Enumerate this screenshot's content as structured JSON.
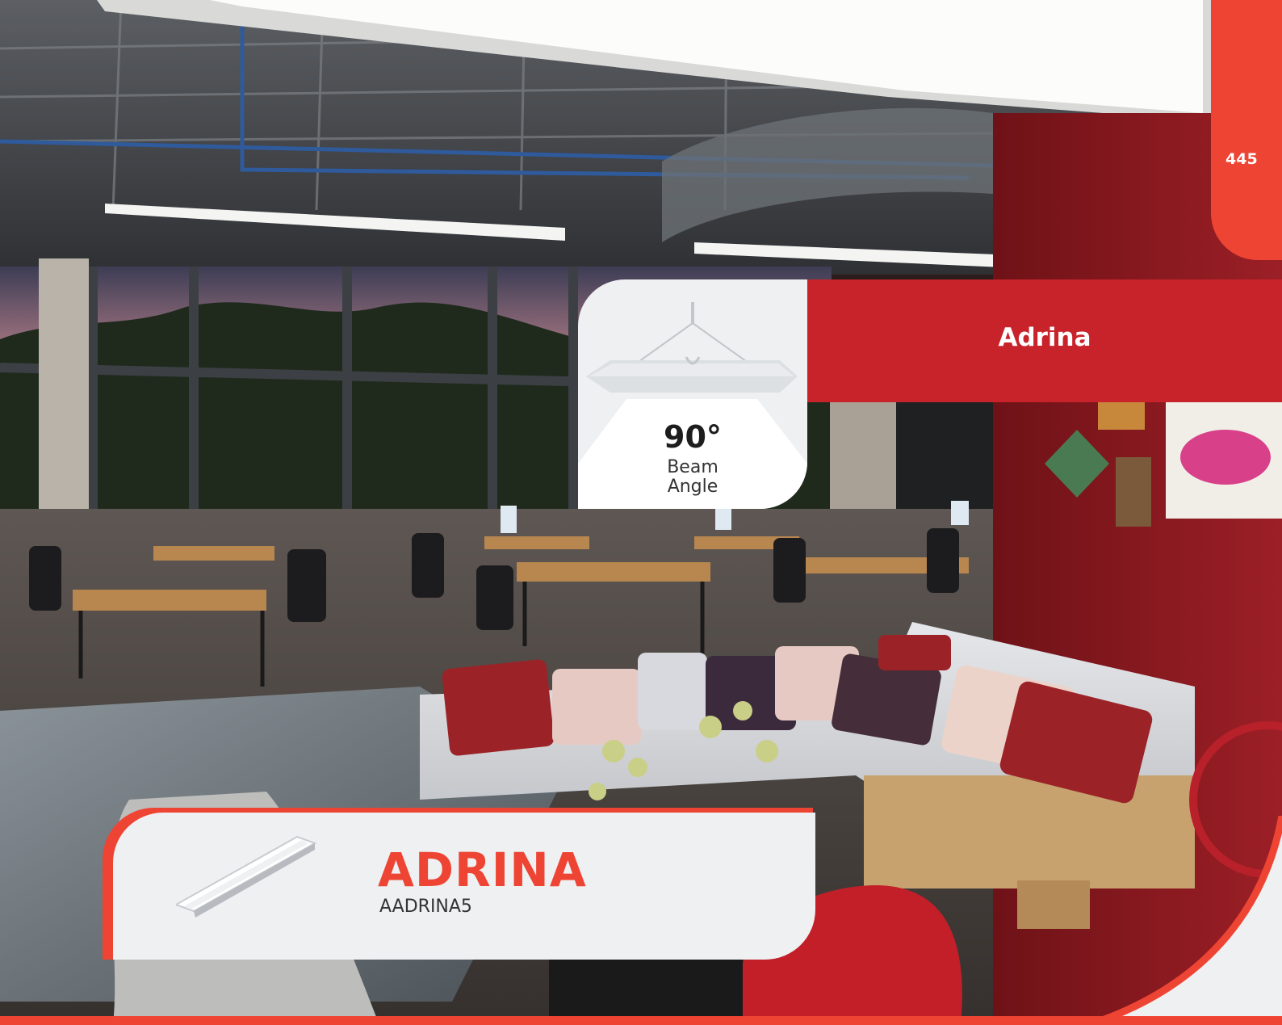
{
  "page": {
    "number": "445"
  },
  "section": {
    "title": "Adrina"
  },
  "beam": {
    "value": "90°",
    "label_line1": "Beam",
    "label_line2": "Angle"
  },
  "product": {
    "name": "ADRINA",
    "code": "AADRINA5"
  },
  "colors": {
    "accent": "#ee4433",
    "band": "#c8232b",
    "card": "#eef0f1",
    "wall": "#8e1c22"
  }
}
